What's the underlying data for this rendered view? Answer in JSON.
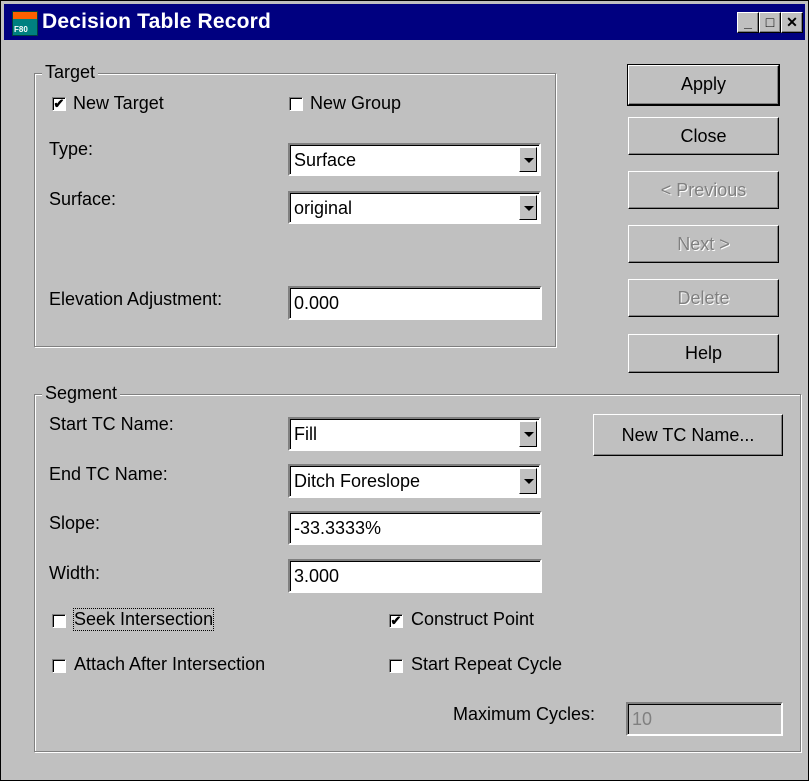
{
  "window": {
    "title": "Decision Table Record",
    "app_icon_text": "F80"
  },
  "titlebar_buttons": {
    "minimize": "_",
    "maximize": "□",
    "close": "✕"
  },
  "target": {
    "group_label": "Target",
    "new_target": {
      "label": "New Target",
      "checked": true
    },
    "new_group": {
      "label": "New Group",
      "checked": false
    },
    "type": {
      "label": "Type:",
      "value": "Surface"
    },
    "surface": {
      "label": "Surface:",
      "value": "original"
    },
    "elevation_adjustment": {
      "label": "Elevation Adjustment:",
      "value": "0.000"
    }
  },
  "buttons": {
    "apply": "Apply",
    "close": "Close",
    "previous": "< Previous",
    "next": "Next >",
    "delete": "Delete",
    "help": "Help",
    "new_tc_name": "New TC Name..."
  },
  "segment": {
    "group_label": "Segment",
    "start_tc_name": {
      "label": "Start TC Name:",
      "value": "Fill"
    },
    "end_tc_name": {
      "label": "End TC Name:",
      "value": "Ditch Foreslope"
    },
    "slope": {
      "label": "Slope:",
      "value": "-33.3333%"
    },
    "width": {
      "label": "Width:",
      "value": "3.000"
    },
    "seek_intersection": {
      "label": "Seek Intersection",
      "checked": false
    },
    "construct_point": {
      "label": "Construct Point",
      "checked": true
    },
    "attach_after_intersection": {
      "label": "Attach After Intersection",
      "checked": false
    },
    "start_repeat_cycle": {
      "label": "Start Repeat Cycle",
      "checked": false
    },
    "maximum_cycles": {
      "label": "Maximum Cycles:",
      "value": "10"
    }
  },
  "marks": {
    "checked": "✔"
  },
  "colors": {
    "titlebar": "#000080",
    "face": "#c0c0c0",
    "disabled_text": "#808080"
  }
}
